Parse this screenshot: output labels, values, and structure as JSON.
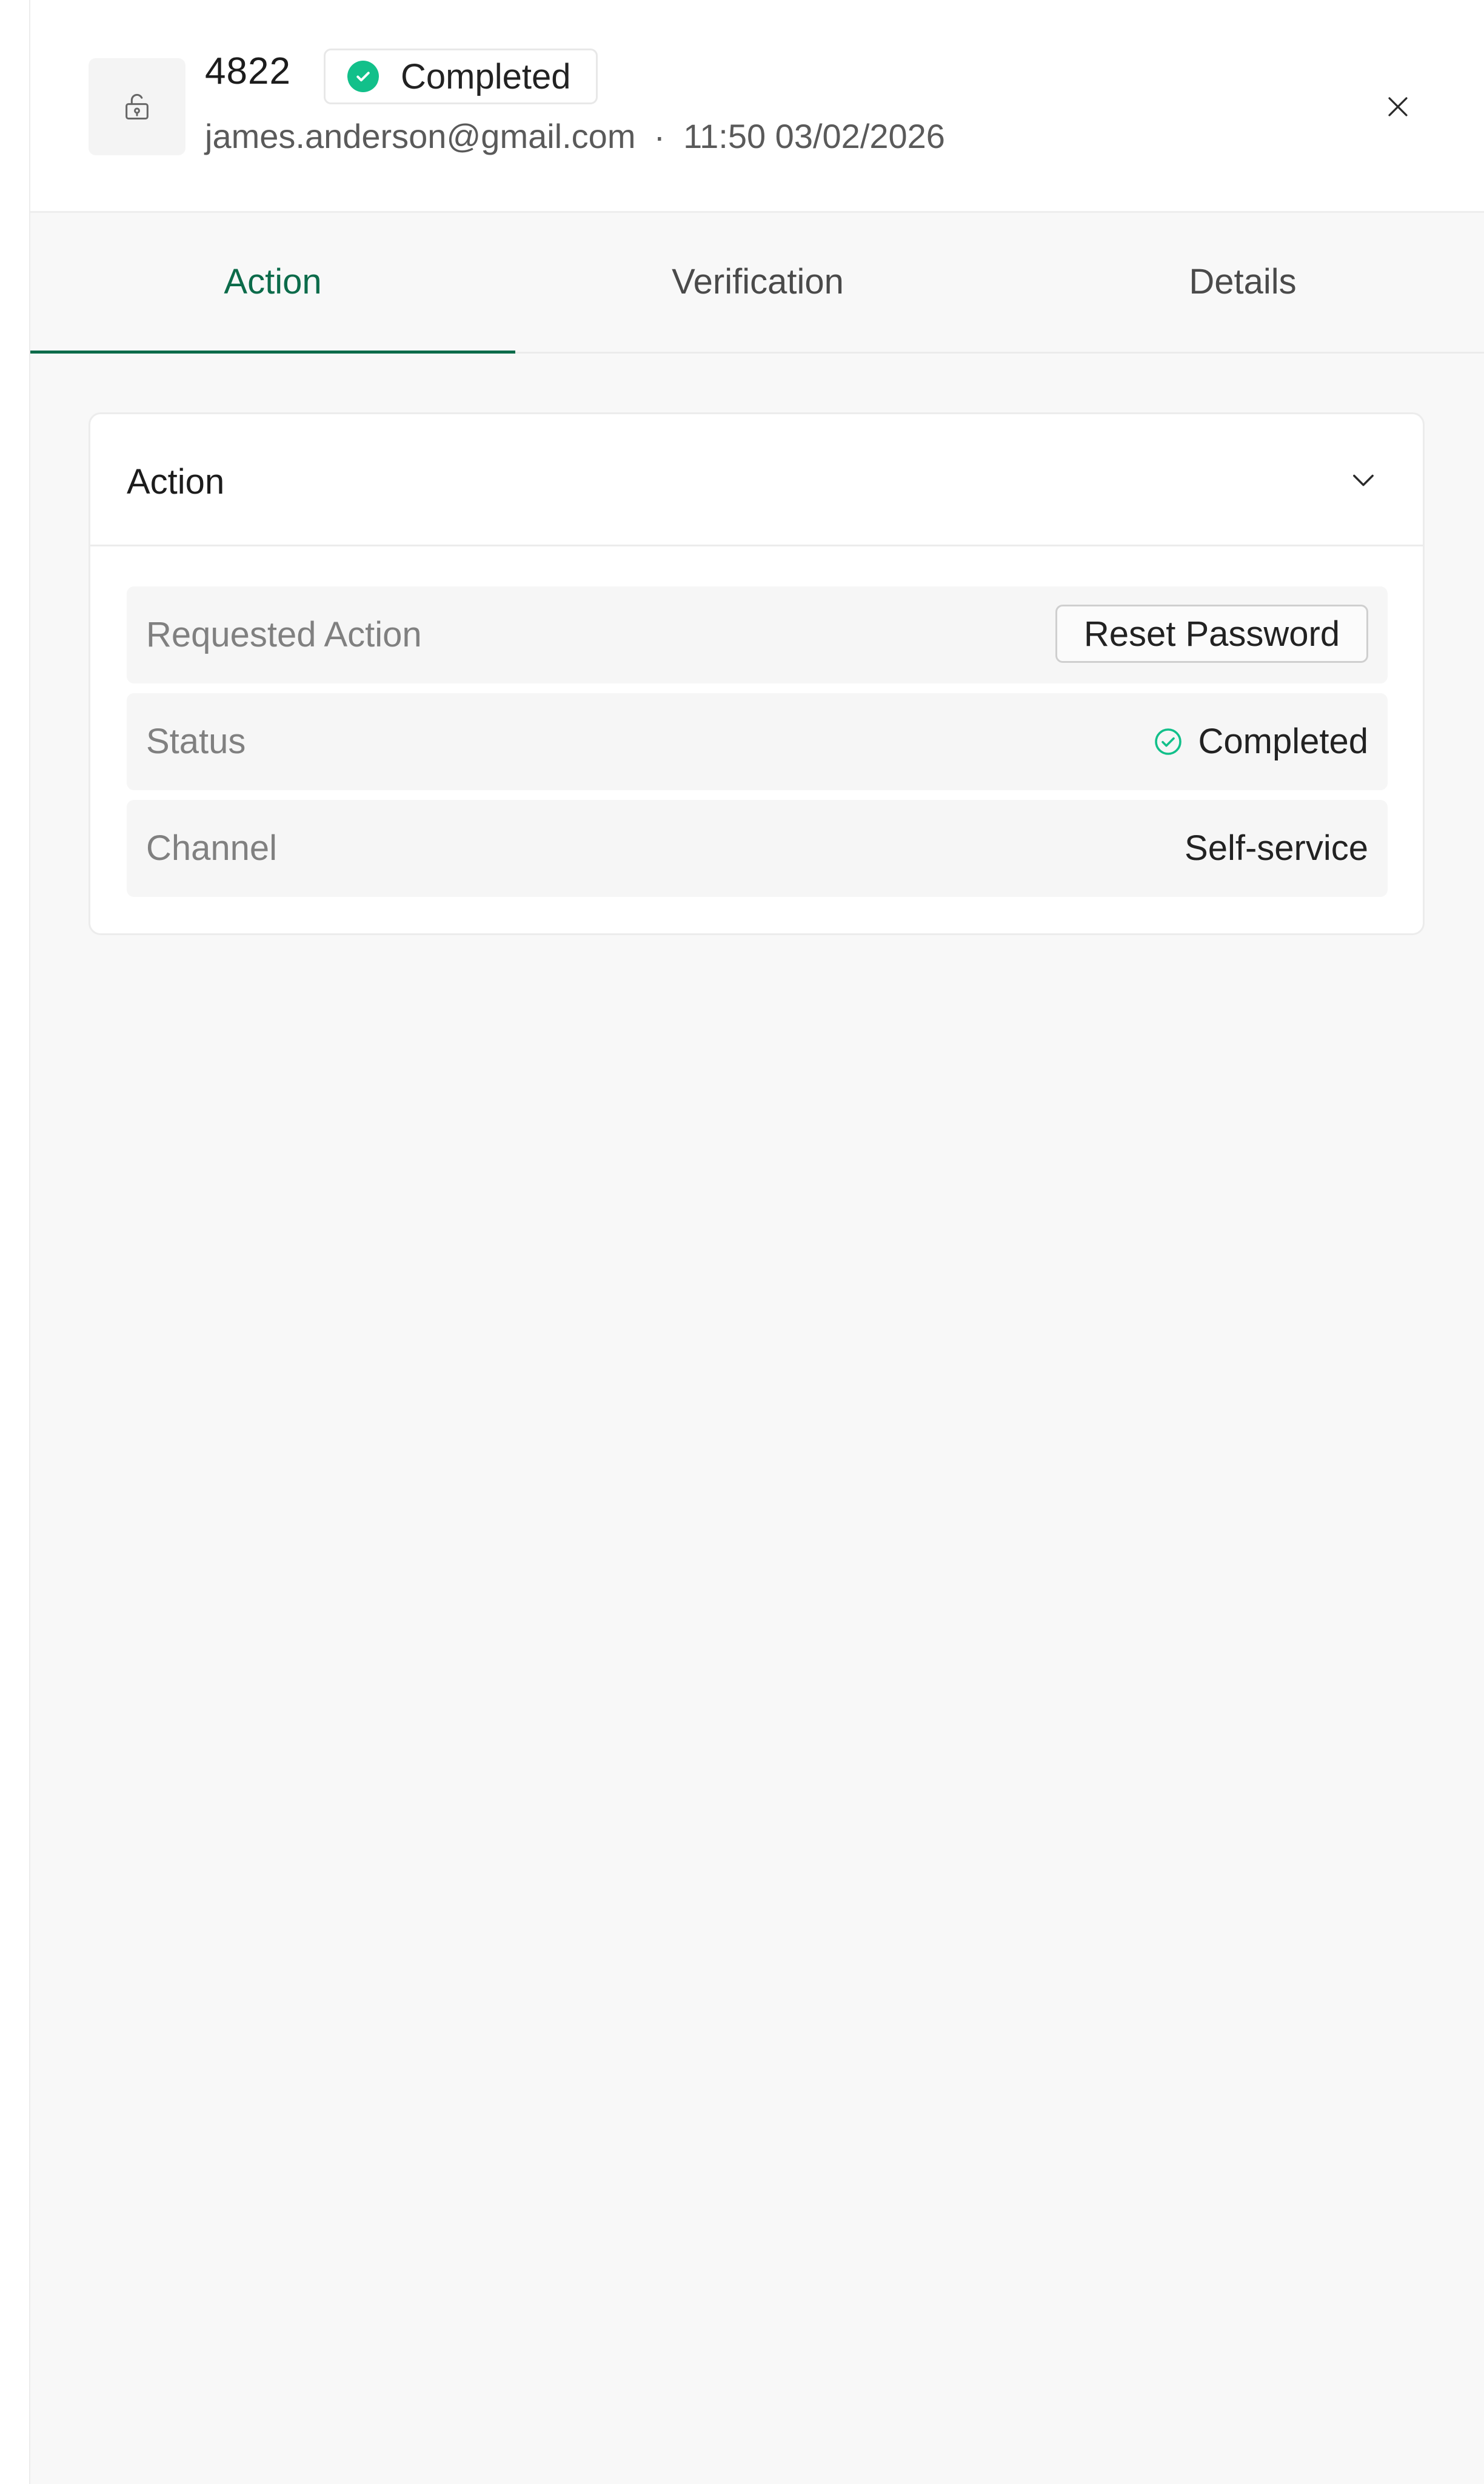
{
  "header": {
    "id": "4822",
    "status": "Completed",
    "email": "james.anderson@gmail.com",
    "separator": "·",
    "timestamp": "11:50 03/02/2026"
  },
  "tabs": [
    {
      "label": "Action",
      "active": true
    },
    {
      "label": "Verification",
      "active": false
    },
    {
      "label": "Details",
      "active": false
    }
  ],
  "card": {
    "title": "Action",
    "rows": [
      {
        "label": "Requested Action",
        "value": "Reset Password"
      },
      {
        "label": "Status",
        "value": "Completed"
      },
      {
        "label": "Channel",
        "value": "Self-service"
      }
    ]
  },
  "colors": {
    "accent": "#0c6b4a",
    "success": "#12c08a",
    "background": "#f8f8f8"
  },
  "icons": {
    "header": "unlock-icon",
    "status": "check-circle-icon",
    "close": "close-icon",
    "collapse": "chevron-down-icon"
  }
}
